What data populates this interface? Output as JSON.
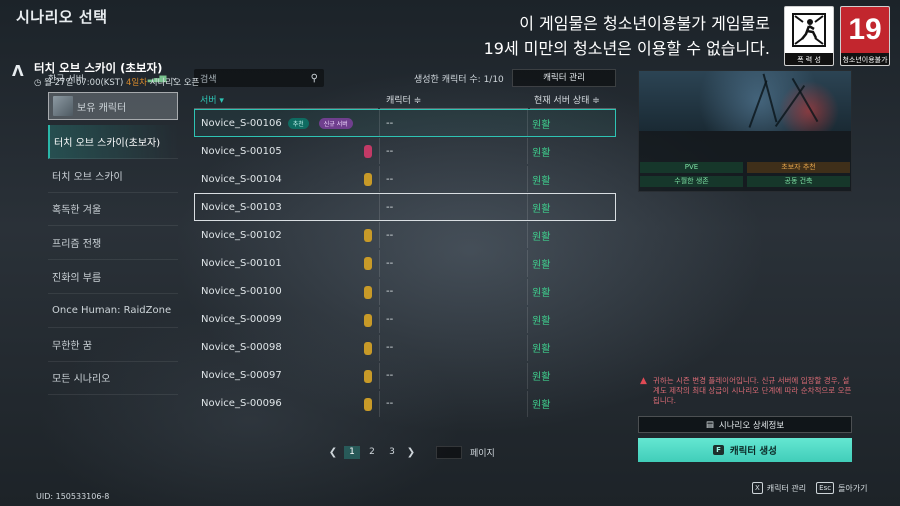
{
  "page": {
    "title": "시나리오 선택"
  },
  "rating": {
    "line1": "이 게임물은 청소년이용불가 게임물로",
    "line2": "19세 미만의 청소년은 이용할 수 없습니다.",
    "badge_violence_caption": "폭 력 성",
    "badge_age_number": "19",
    "badge_age_caption": "청소년이용불가"
  },
  "sidebar": {
    "server_select": "한국 서버",
    "items": [
      {
        "label": "보유 캐릭터"
      },
      {
        "label": "터치 오브 스카이(초보자)"
      },
      {
        "label": "터치 오브 스카이"
      },
      {
        "label": "혹독한 겨울"
      },
      {
        "label": "프리즘 전쟁"
      },
      {
        "label": "진화의 부름"
      },
      {
        "label": "Once Human: RaidZone"
      },
      {
        "label": "무한한 꿈"
      },
      {
        "label": "모든 시나리오"
      }
    ]
  },
  "uid": "UID: 150533106-8",
  "toolbar": {
    "search_placeholder": "검색",
    "count_label": "생성한 캐릭터 수: 1/10",
    "manage_button": "캐릭터 관리"
  },
  "table": {
    "headers": [
      "서버 ▾",
      "캐릭터 ≑",
      "현재 서버 상태 ≑"
    ],
    "tags": {
      "recommended": "추천",
      "new_server": "신규 서버"
    },
    "rows": [
      {
        "server": "Novice_S-00106",
        "character": "--",
        "status": "원활"
      },
      {
        "server": "Novice_S-00105",
        "character": "--",
        "status": "원활"
      },
      {
        "server": "Novice_S-00104",
        "character": "--",
        "status": "원활"
      },
      {
        "server": "Novice_S-00103",
        "character": "--",
        "status": "원활"
      },
      {
        "server": "Novice_S-00102",
        "character": "--",
        "status": "원활"
      },
      {
        "server": "Novice_S-00101",
        "character": "--",
        "status": "원활"
      },
      {
        "server": "Novice_S-00100",
        "character": "--",
        "status": "원활"
      },
      {
        "server": "Novice_S-00099",
        "character": "--",
        "status": "원활"
      },
      {
        "server": "Novice_S-00098",
        "character": "--",
        "status": "원활"
      },
      {
        "server": "Novice_S-00097",
        "character": "--",
        "status": "원활"
      },
      {
        "server": "Novice_S-00096",
        "character": "--",
        "status": "원활"
      }
    ]
  },
  "pagination": {
    "pages": [
      "1",
      "2",
      "3"
    ],
    "current": "1",
    "label": "페이지"
  },
  "card": {
    "title": "터치 오브 스카이 (초보자)",
    "date": "월 27일 07:00(KST)",
    "days": "4일차",
    "suffix": "시나리오 오픈",
    "tags": [
      "PVE",
      "초보자 추천",
      "수월한 생존",
      "공동 건축"
    ]
  },
  "warning": "귀하는 시즌 변경 플레이어입니다. 신규 서버에 입장할 경우, 설계도 제작의 최대 상급이 시나리오 단계에 따라 순차적으로 오픈됩니다.",
  "buttons": {
    "detail": "시나리오 상세정보",
    "create": "캐릭터 생성",
    "create_key": "F"
  },
  "footer": {
    "manage_key": "X",
    "manage_label": "캐릭터 관리",
    "back_key": "Esc",
    "back_label": "돌아가기"
  },
  "colors": {
    "accent": "#2ec4b4",
    "status_ok": "#3fcf8e",
    "warning": "#d76a74",
    "age_badge": "#c2262e"
  }
}
